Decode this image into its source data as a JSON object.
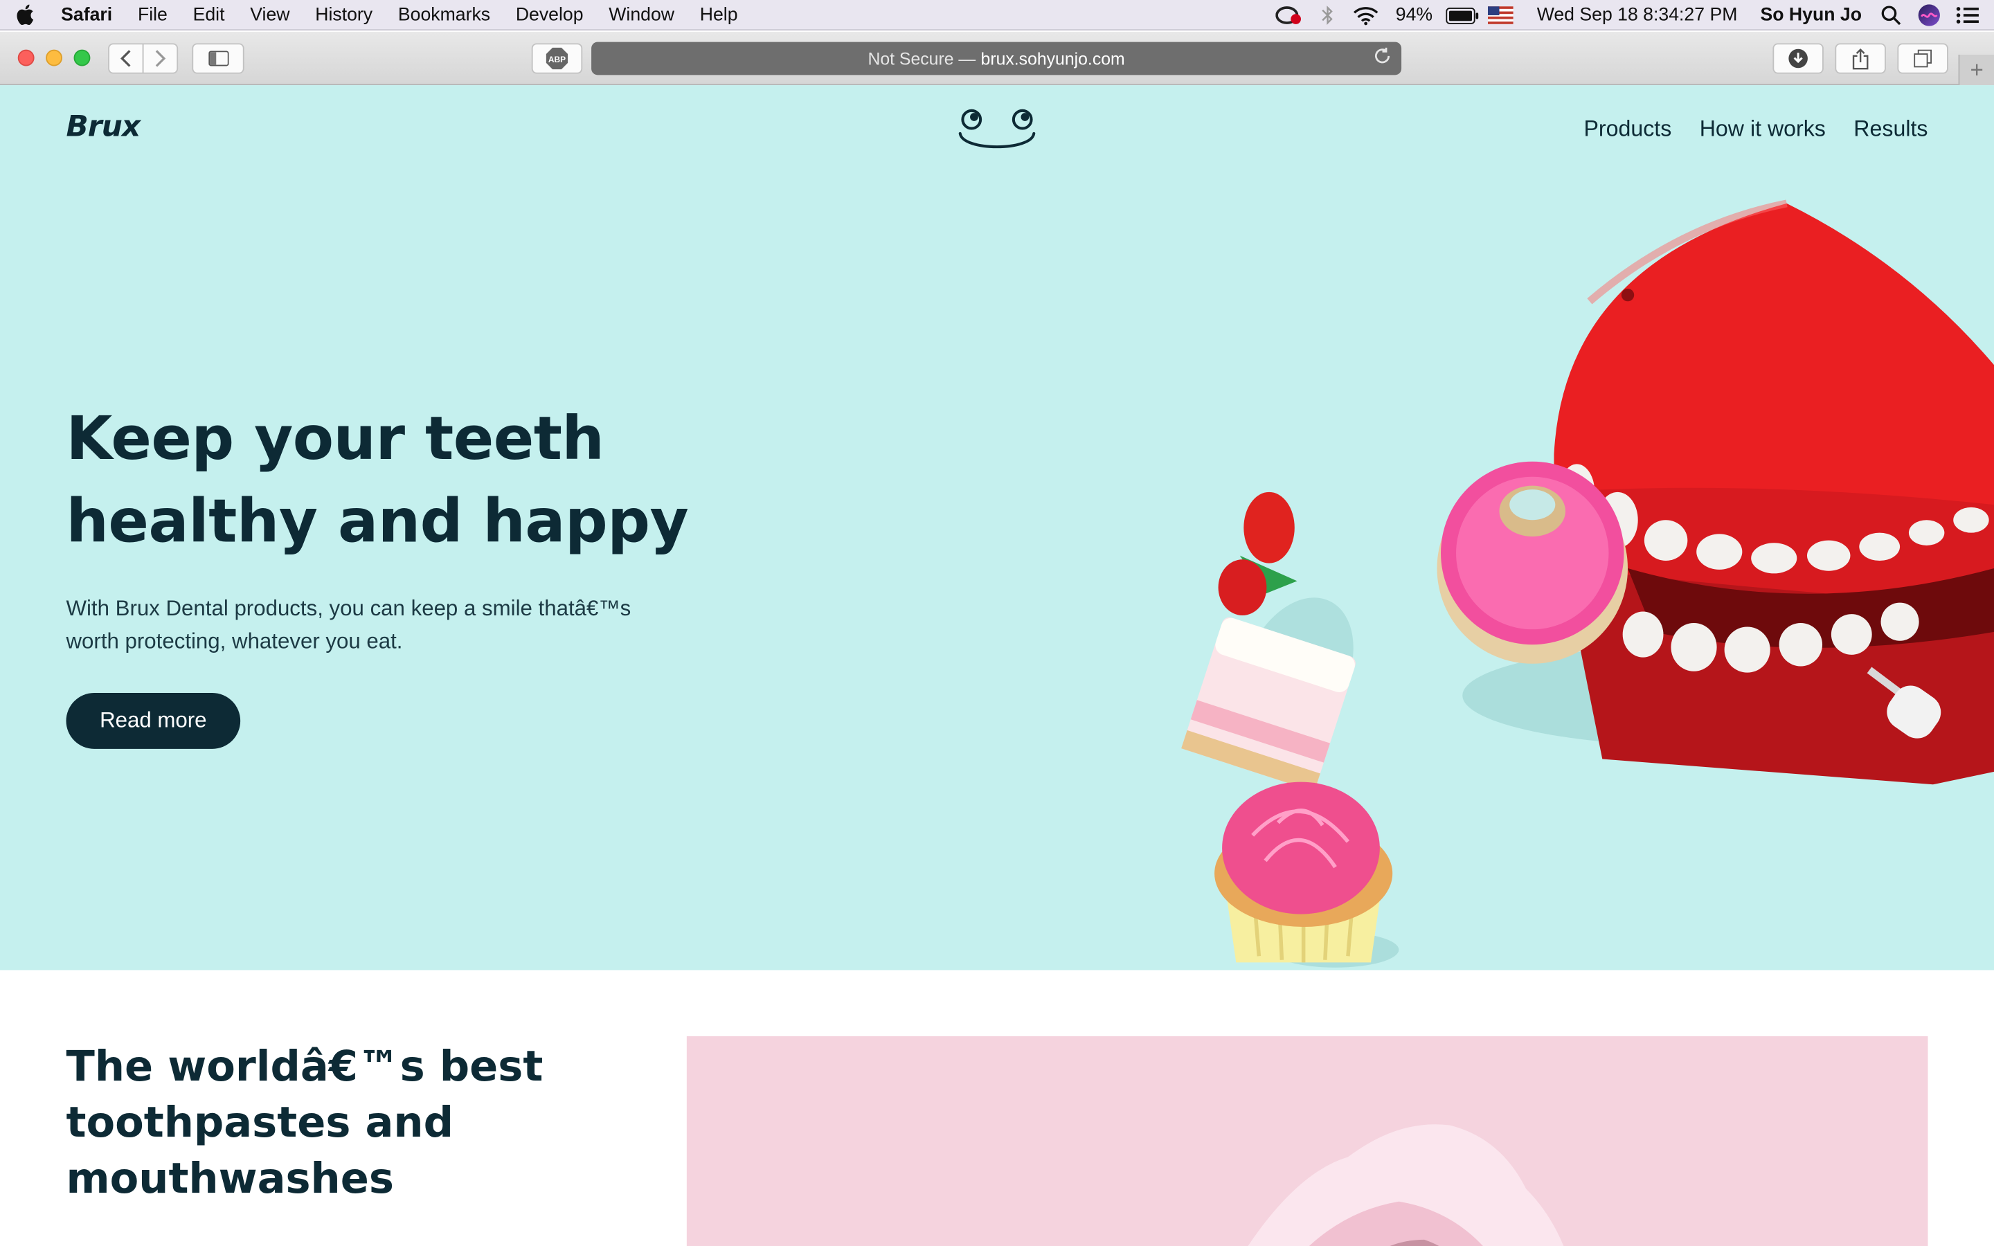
{
  "menubar": {
    "app": "Safari",
    "items": [
      "File",
      "Edit",
      "View",
      "History",
      "Bookmarks",
      "Develop",
      "Window",
      "Help"
    ],
    "battery": "94%",
    "datetime": "Wed Sep 18  8:34:27 PM",
    "user": "So Hyun Jo"
  },
  "toolbar": {
    "adblock_label": "ABP",
    "address_prefix": "Not Secure —",
    "address_domain": "brux.sohyunjo.com",
    "new_tab": "+"
  },
  "nav": {
    "logo": "Brux",
    "links": [
      "Products",
      "How it works",
      "Results"
    ]
  },
  "hero": {
    "title_line1": "Keep your teeth",
    "title_line2": "healthy and happy",
    "subtitle_line1": "With Brux Dental products, you can keep a smile thatâ€™s",
    "subtitle_line2": "worth protecting, whatever you eat.",
    "cta": "Read more"
  },
  "section2": {
    "title_line1": "The worldâ€™s best",
    "title_line2": "toothpastes and",
    "title_line3": "mouthwashes",
    "body_preview": ""
  },
  "colors": {
    "hero_bg": "#c5f0ee",
    "ink": "#0d2a35",
    "pink_panel": "#f5d3de"
  }
}
